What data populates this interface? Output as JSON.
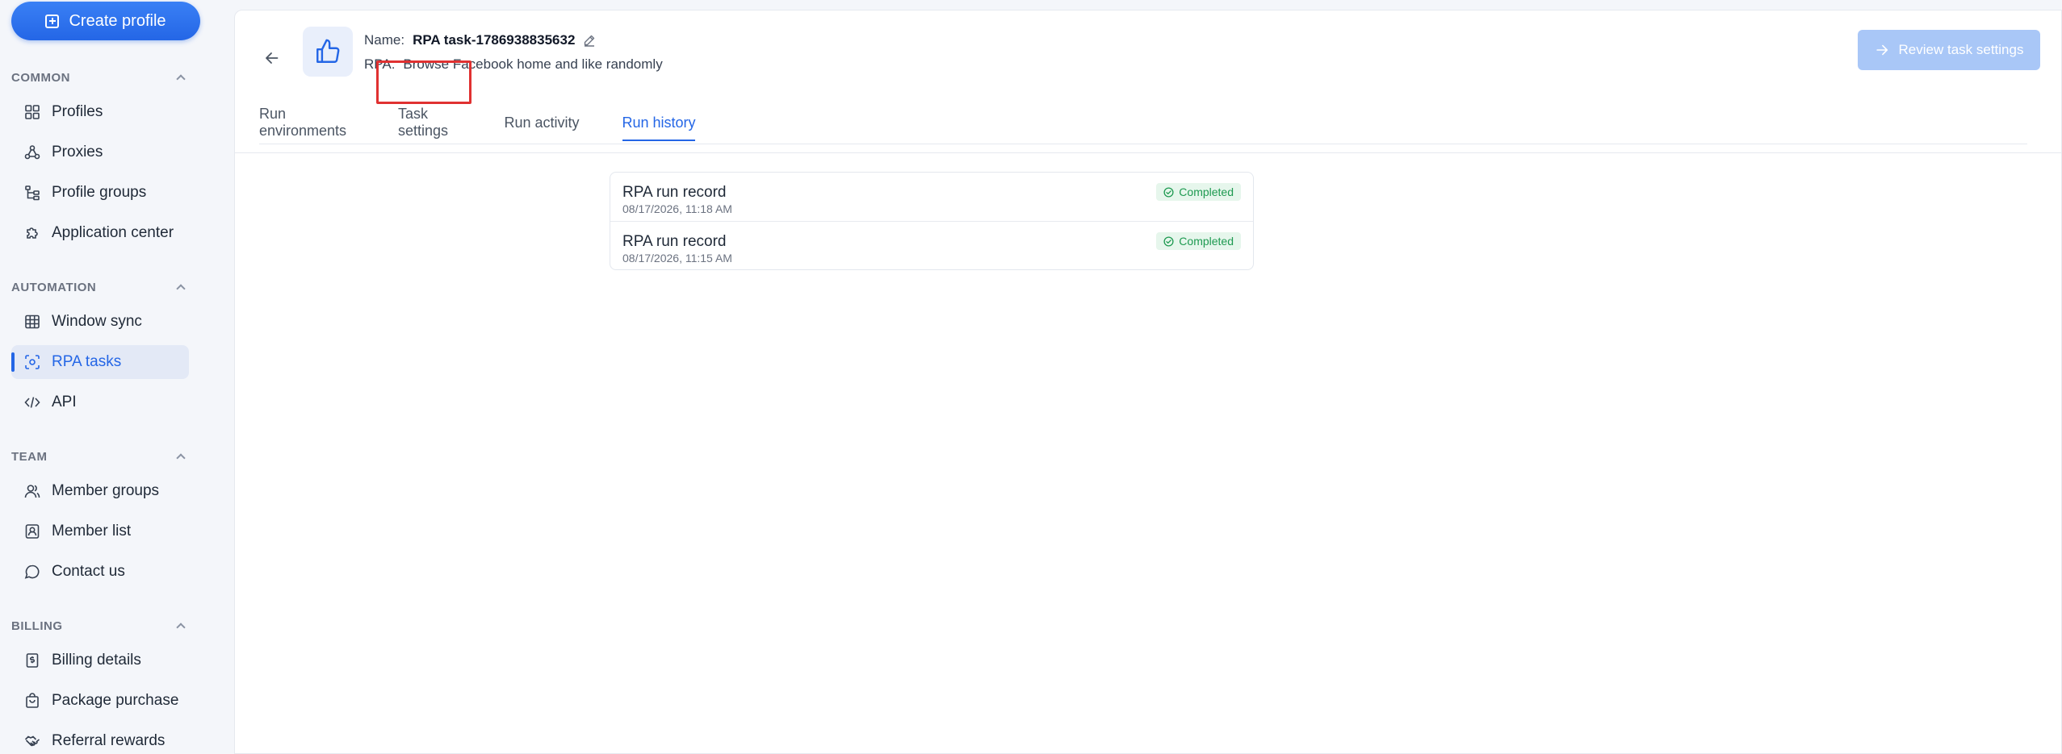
{
  "sidebar": {
    "create_button": "Create profile",
    "sections": [
      {
        "label": "COMMON",
        "items": [
          "Profiles",
          "Proxies",
          "Profile groups",
          "Application center"
        ]
      },
      {
        "label": "AUTOMATION",
        "items": [
          "Window sync",
          "RPA tasks",
          "API"
        ]
      },
      {
        "label": "TEAM",
        "items": [
          "Member groups",
          "Member list",
          "Contact us"
        ]
      },
      {
        "label": "BILLING",
        "items": [
          "Billing details",
          "Package purchase",
          "Referral rewards"
        ]
      }
    ],
    "active_item": "RPA tasks"
  },
  "header": {
    "name_label": "Name:",
    "name_value": "RPA task-1786938835632",
    "rpa_label": "RPA:",
    "rpa_value": "Browse Facebook home and like randomly",
    "review_button": "Review task settings"
  },
  "tabs": [
    {
      "label": "Run environments"
    },
    {
      "label": "Task settings"
    },
    {
      "label": "Run activity"
    },
    {
      "label": "Run history"
    }
  ],
  "active_tab": "Run history",
  "records": [
    {
      "title": "RPA run record",
      "time": "08/17/2026, 11:18 AM",
      "status": "Completed"
    },
    {
      "title": "RPA run record",
      "time": "08/17/2026, 11:15 AM",
      "status": "Completed"
    }
  ],
  "colors": {
    "accent": "#2466e6",
    "status_green": "#1e9a51",
    "highlight": "#e03131"
  }
}
